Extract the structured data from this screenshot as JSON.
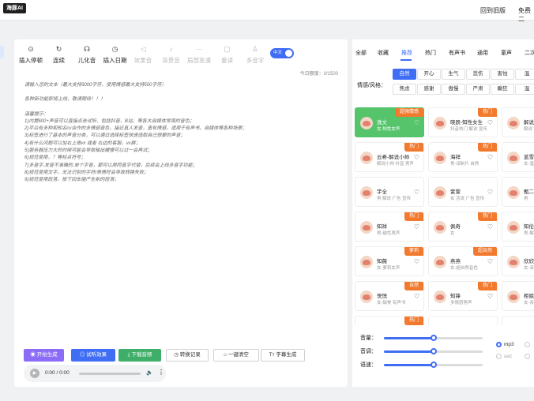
{
  "header": {
    "logo": "海豚AI",
    "links": [
      "回到旧版",
      "免费二"
    ]
  },
  "toolbar": {
    "tools": [
      {
        "label": "插入停顿",
        "icon": "pause-clock-icon",
        "enabled": true
      },
      {
        "label": "连续",
        "icon": "rotate-icon",
        "enabled": true
      },
      {
        "label": "儿化音",
        "icon": "headphones-icon",
        "enabled": true
      },
      {
        "label": "插入日期",
        "icon": "clock-icon",
        "enabled": true
      },
      {
        "label": "效果音",
        "icon": "speaker-icon",
        "enabled": false
      },
      {
        "label": "背景音",
        "icon": "mic-icon",
        "enabled": false
      },
      {
        "label": "局部变速",
        "icon": "dash-icon",
        "enabled": false
      },
      {
        "label": "重读",
        "icon": "square-icon",
        "enabled": false
      },
      {
        "label": "多音字",
        "icon": "person-icon",
        "enabled": false
      }
    ],
    "language_toggle": "中文"
  },
  "editor": {
    "count": "今日额度：0/1500",
    "lines": [
      "请输入您的文本（最大支持3000字符，使用情感最大支持500字符）",
      "",
      "各种新功能即将上线，敬请期待！！！",
      "",
      "温馨提示：",
      "1)内置600+声音可以直接点击试听，包括抖音，B站，等各大自媒体常用的音色；",
      "2)平台有多种和知名cv合作的多情感音色，接近真人发音，富有情感，适用于有声书、自媒体等各种场景；",
      "3)标签进行了基本的声音分类，可以通过选择标签快速选取自己想要的声音；",
      "4)有什么问题可以加右上角vx 或者 右边的客服，vx群；",
      "5)服务器压力大的时候可能会导致输出缓慢可以过一会再试；",
      "6)规范使用，？等标点符号；",
      "7)多音字,发音不准确的,单个字音，都可以用同音字代替，后续会上线多音字功能；",
      "8)规范使用文字，无法识别的字符/表情符会导致转换失败；",
      "9)规范使用段落，按下回车键产生新的段落；"
    ]
  },
  "actions": {
    "buttons": [
      {
        "label": "开始生成",
        "icon": "play-circle-icon",
        "style": "primary",
        "color": "#8b6cf6"
      },
      {
        "label": "试听效果",
        "icon": "headset-icon",
        "style": "primary",
        "color": "#3f6ef5"
      },
      {
        "label": "下载音频",
        "icon": "download-icon",
        "style": "primary",
        "color": "#3fae6a"
      },
      {
        "label": "转换记录",
        "icon": "history-icon",
        "style": "plain",
        "color": "#ffffff"
      },
      {
        "label": "一键清空",
        "icon": "trash-icon",
        "style": "plain",
        "color": "#ffffff"
      },
      {
        "label": "字幕生成",
        "icon": "subtitle-icon",
        "style": "plain",
        "color": "#ffffff"
      }
    ]
  },
  "player": {
    "time": "0:00 / 0:00"
  },
  "voice_panel": {
    "tabs": [
      "全部",
      "收藏",
      "推荐",
      "热门",
      "有声书",
      "通用",
      "童声",
      "二次"
    ],
    "active_tab": 2,
    "style_label": "情感/风格：",
    "chips": [
      [
        "自然",
        "开心",
        "生气",
        "悲伤",
        "害怕",
        "温"
      ],
      [
        "焦虑",
        "感谢",
        "傲慢",
        "严肃",
        "癫狂",
        "温"
      ]
    ],
    "active_chip": "自然",
    "voices": [
      [
        {
          "name": "逸文",
          "desc": "女-知性女声",
          "badge": "超强情感",
          "badge_color": "#f27a2e",
          "selected": true
        },
        {
          "name": "晓辰-知性女生",
          "desc": "抖音热门 解说 宣传",
          "badge": "热门",
          "badge_color": "#f27a2e",
          "selected": false
        },
        {
          "name": "解说",
          "desc": "解说 抖音",
          "badge": "",
          "badge_color": "",
          "selected": false
        }
      ],
      [
        {
          "name": "云希-解说小帅",
          "desc": "解说小帅 抖音 男声",
          "badge": "热门",
          "badge_color": "#f27a2e",
          "selected": false
        },
        {
          "name": "海祥",
          "desc": "男-译制片 自然",
          "badge": "热门",
          "badge_color": "#f27a2e",
          "selected": false
        },
        {
          "name": "蓝雪",
          "desc": "女-温柔",
          "badge": "",
          "badge_color": "",
          "selected": false
        }
      ],
      [
        {
          "name": "宇全",
          "desc": "男 解说 广告 宣传",
          "badge": "",
          "badge_color": "",
          "selected": false
        },
        {
          "name": "紫萱",
          "desc": "女 活泼 广告 宣传",
          "badge": "",
          "badge_color": "",
          "selected": false
        },
        {
          "name": "甄二",
          "desc": "男",
          "badge": "",
          "badge_color": "",
          "selected": false
        }
      ],
      [
        {
          "name": "知祥",
          "desc": "男-磁性男声",
          "badge": "热门",
          "badge_color": "#f27a2e",
          "selected": false
        },
        {
          "name": "佩奇",
          "desc": "女",
          "badge": "热门",
          "badge_color": "#f27a2e",
          "selected": false
        },
        {
          "name": "知伦",
          "desc": "男-解说",
          "badge": "",
          "badge_color": "",
          "selected": false
        }
      ],
      [
        {
          "name": "知薇",
          "desc": "女-萝莉女声",
          "badge": "萝莉",
          "badge_color": "#f27a2e",
          "selected": false
        },
        {
          "name": "燕燕",
          "desc": "女-超自然音色",
          "badge": "超自然",
          "badge_color": "#f27a2e",
          "selected": false
        },
        {
          "name": "欣欣",
          "desc": "女-亲和",
          "badge": "",
          "badge_color": "",
          "selected": false
        }
      ],
      [
        {
          "name": "悦悦",
          "desc": "女-甜美 有声书",
          "badge": "自然",
          "badge_color": "#f27a2e",
          "selected": false
        },
        {
          "name": "知锋",
          "desc": "多情感男声",
          "badge": "热门",
          "badge_color": "#f27a2e",
          "selected": false
        },
        {
          "name": "柜姐",
          "desc": "女-亲切",
          "badge": "",
          "badge_color": "",
          "selected": false
        }
      ],
      [
        {
          "name": "",
          "desc": "",
          "badge": "热门",
          "badge_color": "#f27a2e",
          "selected": false
        },
        {
          "name": "",
          "desc": "",
          "badge": "",
          "badge_color": "",
          "selected": false
        },
        {
          "name": "",
          "desc": "",
          "badge": "",
          "badge_color": "",
          "selected": false
        }
      ]
    ]
  },
  "settings": {
    "sliders": [
      {
        "label": "音量：",
        "value": 0.5
      },
      {
        "label": "音调：",
        "value": 0.5
      },
      {
        "label": "语速：",
        "value": 0.5
      }
    ],
    "formats": [
      {
        "label": "mp3",
        "checked": true,
        "enabled": true
      },
      {
        "label": "",
        "checked": false,
        "enabled": false
      },
      {
        "label": "aac",
        "checked": false,
        "enabled": false
      },
      {
        "label": "",
        "checked": false,
        "enabled": false
      }
    ]
  }
}
